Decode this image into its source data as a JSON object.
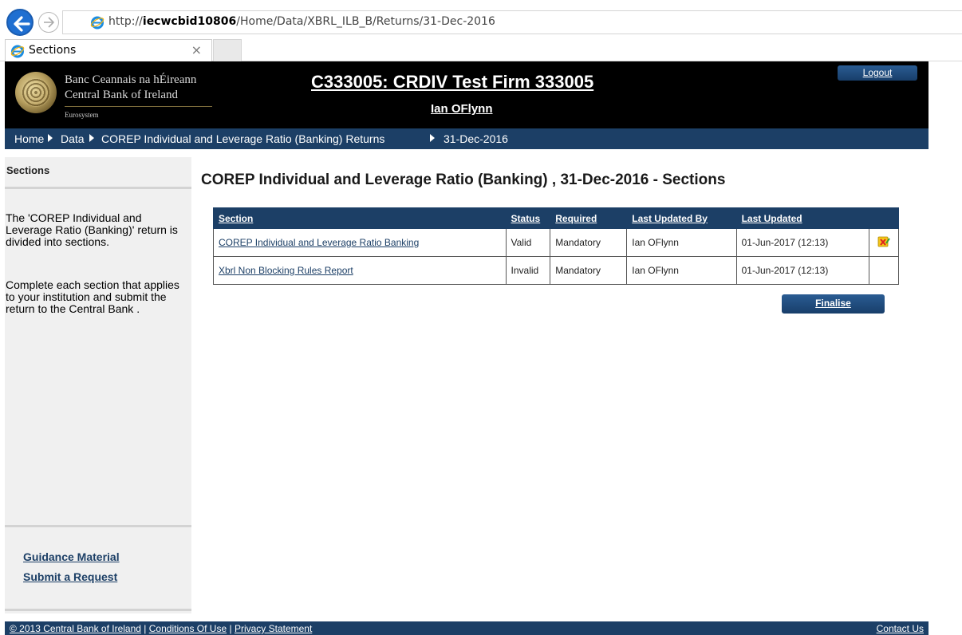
{
  "browser": {
    "url_prefix": "http://",
    "url_host": "iecwcbid10806",
    "url_path": "/Home/Data/XBRL_ILB_B/Returns/31-Dec-2016",
    "tab_title": "Sections",
    "tab_close": "×"
  },
  "header": {
    "bank_name_ga": "Banc Ceannais na hÉireann",
    "bank_name_en": "Central Bank of Ireland",
    "eurosystem": "Eurosystem",
    "firm_title": "C333005: CRDIV Test Firm 333005",
    "user_name": "Ian OFlynn",
    "logout_label": "Logout"
  },
  "breadcrumb": {
    "home": "Home",
    "data": "Data",
    "returns": "COREP Individual and Leverage Ratio (Banking) Returns",
    "current": "31-Dec-2016"
  },
  "sidebar": {
    "title": "Sections",
    "para1": "The 'COREP Individual and Leverage Ratio (Banking)' return is divided into sections.",
    "para2": "Complete each section that applies to your institution and submit the return to the Central Bank .",
    "links": [
      "Guidance Material",
      "Submit a Request"
    ]
  },
  "main": {
    "heading": "COREP Individual and Leverage Ratio (Banking) , 31-Dec-2016 - Sections",
    "columns": [
      "Section",
      "Status",
      "Required",
      "Last Updated By",
      "Last Updated",
      ""
    ],
    "rows": [
      {
        "section": "COREP Individual and Leverage Ratio Banking",
        "status": "Valid",
        "required": "Mandatory",
        "updated_by": "Ian OFlynn",
        "updated": "01-Jun-2017 (12:13)",
        "icon": "validation-warning-icon"
      },
      {
        "section": "Xbrl Non Blocking Rules Report",
        "status": "Invalid",
        "required": "Mandatory",
        "updated_by": "Ian OFlynn",
        "updated": "01-Jun-2017 (12:13)",
        "icon": ""
      }
    ],
    "finalise_label": "Finalise"
  },
  "footer": {
    "copyright": "© 2013 Central Bank of Ireland",
    "sep": " | ",
    "conditions": "Conditions Of Use",
    "privacy": "Privacy Statement",
    "contact": "Contact Us"
  },
  "colors": {
    "navy": "#1c3f66",
    "header_bg": "#000000",
    "sidebar_bg": "#f0f0f0"
  }
}
